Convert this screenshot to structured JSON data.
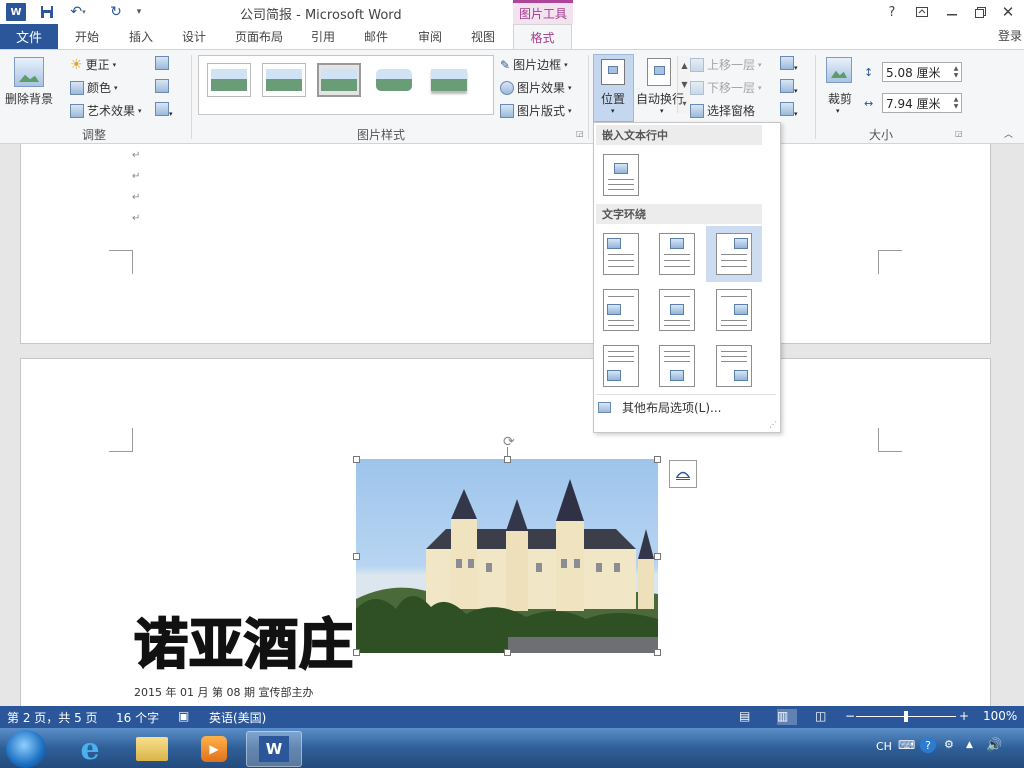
{
  "title_bar": {
    "doc_title": "公司简报 - Microsoft Word",
    "context_tab": "图片工具",
    "signin": "登录",
    "help": "?",
    "app_icon": "W"
  },
  "tabs": [
    "文件",
    "开始",
    "插入",
    "设计",
    "页面布局",
    "引用",
    "邮件",
    "审阅",
    "视图",
    "格式"
  ],
  "ribbon": {
    "adjust": {
      "remove_bg": "删除背景",
      "corrections": "更正",
      "color": "颜色",
      "artistic": "艺术效果",
      "group_label": "调整"
    },
    "picture_styles": {
      "border": "图片边框",
      "effects": "图片效果",
      "layout": "图片版式",
      "group_label": "图片样式"
    },
    "arrange": {
      "position": "位置",
      "wrap_text": "自动换行",
      "bring_forward": "上移一层",
      "send_backward": "下移一层",
      "selection_pane": "选择窗格"
    },
    "size": {
      "crop": "裁剪",
      "height": "5.08 厘米",
      "width": "7.94 厘米",
      "group_label": "大小"
    }
  },
  "position_menu": {
    "section_inline": "嵌入文本行中",
    "section_wrap": "文字环绕",
    "more_options": "其他布局选项(L)..."
  },
  "document": {
    "headline": "诺亚酒庄",
    "subline": "2015 年 01 月    第 08 期    宣传部主办"
  },
  "status_bar": {
    "page": "第 2 页，共 5 页",
    "words": "16 个字",
    "language": "英语(美国)",
    "zoom": "100%",
    "zoom_fraction": 0.5
  },
  "taskbar": {
    "ime": "CH"
  },
  "colors": {
    "word_blue": "#2b579a",
    "picture_tools_accent": "#a33b8f",
    "selected_option": "#cddcf0"
  }
}
